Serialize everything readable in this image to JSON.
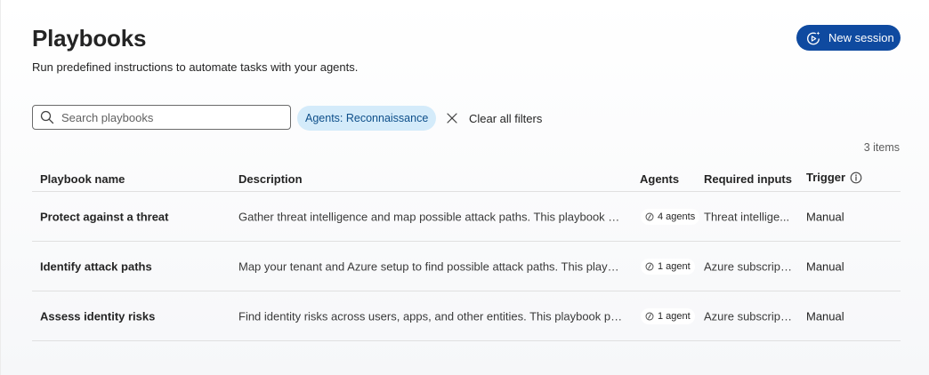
{
  "header": {
    "title": "Playbooks",
    "subtitle": "Run predefined instructions to automate tasks with your agents.",
    "new_session_label": "New session"
  },
  "filters": {
    "search_placeholder": "Search playbooks",
    "search_value": "",
    "active_chip": "Agents: Reconnaissance",
    "clear_label": "Clear all filters"
  },
  "table": {
    "count": "3 items",
    "columns": {
      "name": "Playbook name",
      "description": "Description",
      "agents": "Agents",
      "inputs": "Required inputs",
      "trigger": "Trigger"
    },
    "rows": [
      {
        "name": "Protect against a threat",
        "description": "Gather threat intelligence and map possible attack paths. This playbook pro...",
        "agents": "4 agents",
        "inputs": "Threat intellige...",
        "trigger": "Manual"
      },
      {
        "name": "Identify attack paths",
        "description": "Map your tenant and Azure setup to find possible attack paths. This playbo...",
        "agents": "1 agent",
        "inputs": "Azure subscripti...",
        "trigger": "Manual"
      },
      {
        "name": "Assess identity risks",
        "description": "Find identity risks across users, apps, and other entities. This playbook provi...",
        "agents": "1 agent",
        "inputs": "Azure subscripti...",
        "trigger": "Manual"
      }
    ]
  },
  "icons": {
    "new_session": "sparkle-play-icon",
    "search": "search-icon",
    "clear": "close-icon",
    "trigger_info": "info-icon",
    "agent": "agent-icon"
  },
  "colors": {
    "primary": "#0f4aa0",
    "chip_bg": "#d4ebfa",
    "chip_text": "#0e4f8a"
  }
}
